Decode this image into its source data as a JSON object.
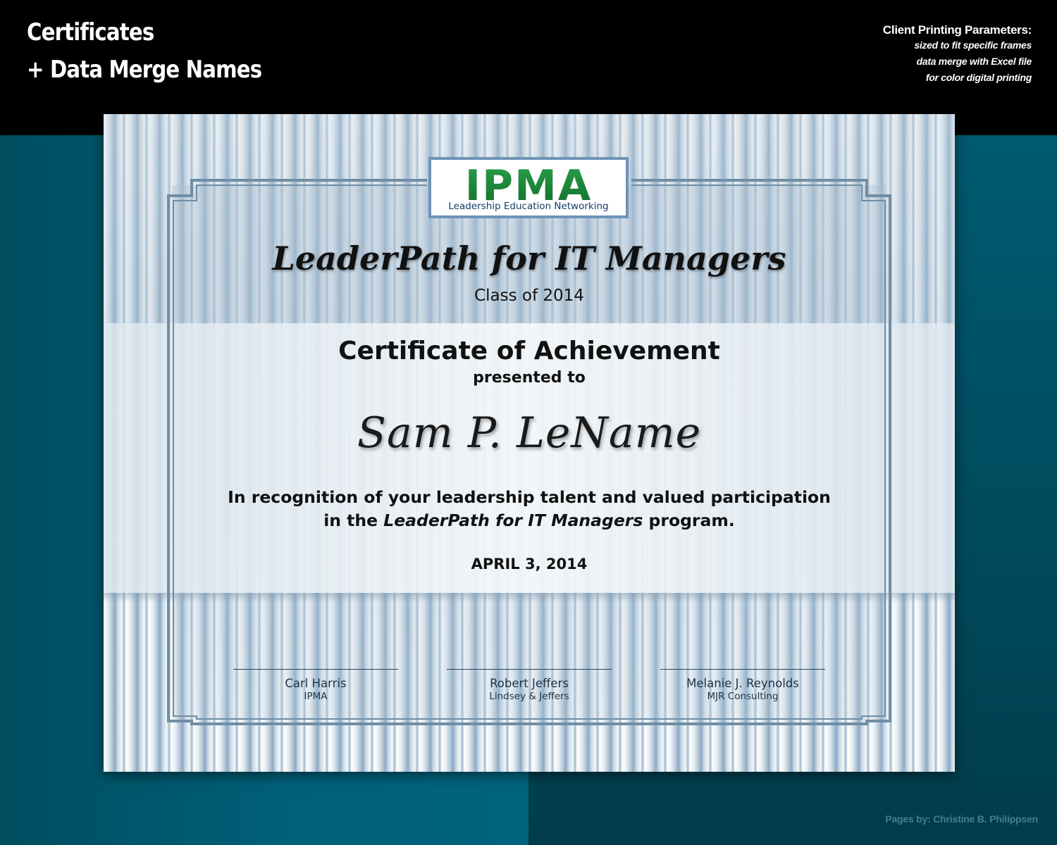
{
  "header": {
    "title_line1": "Certificates",
    "title_line2": "+ Data Merge Names",
    "params_heading": "Client Printing Parameters:",
    "params_lines": [
      "sized to fit specific frames",
      "data merge with Excel file",
      "for color digital printing"
    ]
  },
  "certificate": {
    "logo": {
      "mark": "IPMA",
      "tagline": "Leadership Education Networking"
    },
    "program_title": "LeaderPath for IT Managers",
    "class_of": "Class of 2014",
    "certificate_title": "Certificate of Achievement",
    "presented_to": "presented to",
    "recipient_name": "Sam P. LeName",
    "recognition_line1": "In recognition of your leadership talent and valued participation",
    "recognition_line2_prefix": "in the",
    "recognition_line2_program": "LeaderPath for IT Managers",
    "recognition_line2_suffix": "program.",
    "date": "APRIL 3, 2014",
    "signatories": [
      {
        "name": "Carl Harris",
        "org": "IPMA"
      },
      {
        "name": "Robert Jeffers",
        "org": "Lindsey & Jeffers"
      },
      {
        "name": "Melanie J. Reynolds",
        "org": "MJR Consulting"
      }
    ]
  },
  "footer": {
    "credit": "Pages by:  Christine B. Philippsen"
  },
  "colors": {
    "logo_green": "#1e8a3c",
    "logo_blue": "#123d6b",
    "frame": "#6f8ea5",
    "background_teal": "#00495c"
  }
}
